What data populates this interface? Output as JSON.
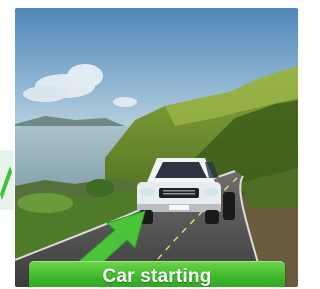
{
  "slide": {
    "caption": "Car starting",
    "caption_color": "#3ab52a",
    "arrow_icon": "up-right-arrow-icon",
    "scene_subject": "white-suv-on-mountain-lake-road"
  }
}
